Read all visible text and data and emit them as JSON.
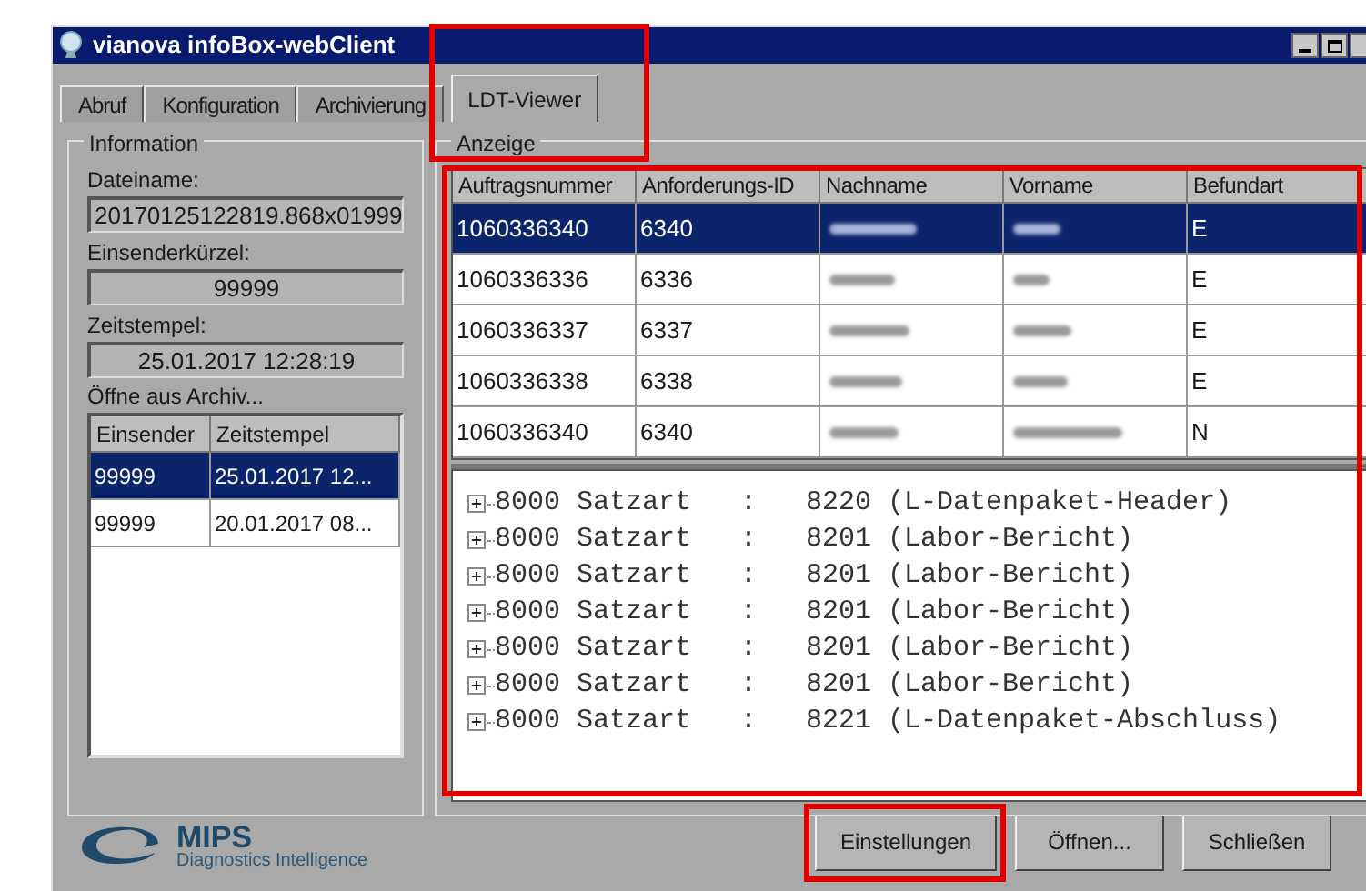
{
  "window": {
    "title": "vianova infoBox-webClient"
  },
  "tabs": [
    {
      "label": "Abruf",
      "selected": false
    },
    {
      "label": "Konfiguration",
      "selected": false
    },
    {
      "label": "Archivierung",
      "selected": false
    },
    {
      "label": "LDT-Viewer",
      "selected": true
    }
  ],
  "information": {
    "title": "Information",
    "fields": [
      {
        "label": "Dateiname:",
        "value": "20170125122819.868x01999",
        "centered": false
      },
      {
        "label": "Einsenderkürzel:",
        "value": "99999",
        "centered": true
      },
      {
        "label": "Zeitstempel:",
        "value": "25.01.2017 12:28:19",
        "centered": true
      }
    ],
    "archive_label": "Öffne aus Archiv...",
    "archive_table": {
      "columns": [
        "Einsender",
        "Zeitstempel"
      ],
      "rows": [
        {
          "cells": [
            "99999",
            "25.01.2017 12..."
          ],
          "selected": true
        },
        {
          "cells": [
            "99999",
            "20.01.2017 08..."
          ],
          "selected": false
        }
      ]
    }
  },
  "display": {
    "title": "Anzeige",
    "table": {
      "columns": [
        "Auftragsnummer",
        "Anforderungs-ID",
        "Nachname",
        "Vorname",
        "Befundart"
      ],
      "rows": [
        {
          "selected": true,
          "cells": [
            {
              "kind": "text",
              "text": "1060336340"
            },
            {
              "kind": "text",
              "text": "6340"
            },
            {
              "kind": "redacted"
            },
            {
              "kind": "redacted"
            },
            {
              "kind": "text",
              "text": "E"
            }
          ]
        },
        {
          "selected": false,
          "cells": [
            {
              "kind": "text",
              "text": "1060336336"
            },
            {
              "kind": "text",
              "text": "6336"
            },
            {
              "kind": "redacted"
            },
            {
              "kind": "redacted"
            },
            {
              "kind": "text",
              "text": "E"
            }
          ]
        },
        {
          "selected": false,
          "cells": [
            {
              "kind": "text",
              "text": "1060336337"
            },
            {
              "kind": "text",
              "text": "6337"
            },
            {
              "kind": "redacted"
            },
            {
              "kind": "redacted"
            },
            {
              "kind": "text",
              "text": "E"
            }
          ]
        },
        {
          "selected": false,
          "cells": [
            {
              "kind": "text",
              "text": "1060336338"
            },
            {
              "kind": "text",
              "text": "6338"
            },
            {
              "kind": "redacted"
            },
            {
              "kind": "redacted"
            },
            {
              "kind": "text",
              "text": "E"
            }
          ]
        },
        {
          "selected": false,
          "cells": [
            {
              "kind": "text",
              "text": "1060336340"
            },
            {
              "kind": "text",
              "text": "6340"
            },
            {
              "kind": "redacted"
            },
            {
              "kind": "redacted"
            },
            {
              "kind": "text",
              "text": "N"
            }
          ]
        }
      ]
    },
    "tree": [
      {
        "text": "8000 Satzart   :   8220 (L-Datenpaket-Header)",
        "expanded": false
      },
      {
        "text": "8000 Satzart   :   8201 (Labor-Bericht)",
        "expanded": false
      },
      {
        "text": "8000 Satzart   :   8201 (Labor-Bericht)",
        "expanded": false
      },
      {
        "text": "8000 Satzart   :   8201 (Labor-Bericht)",
        "expanded": false
      },
      {
        "text": "8000 Satzart   :   8201 (Labor-Bericht)",
        "expanded": false
      },
      {
        "text": "8000 Satzart   :   8201 (Labor-Bericht)",
        "expanded": false
      },
      {
        "text": "8000 Satzart   :   8221 (L-Datenpaket-Abschluss)",
        "expanded": false
      }
    ]
  },
  "logo": {
    "name": "MIPS",
    "tagline": "Diagnostics Intelligence"
  },
  "buttons": [
    "Einstellungen",
    "Öffnen...",
    "Schließen"
  ]
}
